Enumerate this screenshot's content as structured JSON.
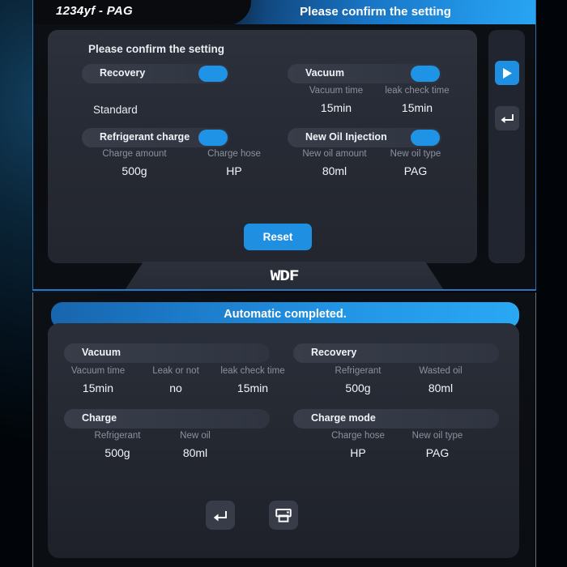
{
  "top_panel": {
    "titlebar": {
      "model": "1234yf - PAG",
      "title": "Please confirm the setting"
    },
    "card_heading": "Please confirm the setting",
    "standard_label": "Standard",
    "sections": {
      "recovery": {
        "label": "Recovery",
        "toggle": "on"
      },
      "refrigerant_charge": {
        "label": "Refrigerant charge",
        "toggle": "on",
        "fields": [
          {
            "label": "Charge amount",
            "value": "500g"
          },
          {
            "label": "Charge hose",
            "value": "HP"
          }
        ]
      },
      "vacuum": {
        "label": "Vacuum",
        "toggle": "on",
        "fields": [
          {
            "label": "Vacuum time",
            "value": "15min"
          },
          {
            "label": "leak check time",
            "value": "15min"
          }
        ]
      },
      "new_oil_injection": {
        "label": "New Oil Injection",
        "toggle": "on",
        "fields": [
          {
            "label": "New oil amount",
            "value": "80ml"
          },
          {
            "label": "New oil type",
            "value": "PAG"
          }
        ]
      }
    },
    "reset_label": "Reset",
    "rail": {
      "play_icon": "play-icon",
      "back_icon": "return-arrow-icon"
    },
    "brand": "WDF"
  },
  "bottom_panel": {
    "header_title": "Automatic completed.",
    "groups": {
      "vacuum": {
        "label": "Vacuum",
        "fields": [
          {
            "label": "Vacuum time",
            "value": "15min"
          },
          {
            "label": "Leak or not",
            "value": "no"
          },
          {
            "label": "leak check time",
            "value": "15min"
          }
        ]
      },
      "recovery": {
        "label": "Recovery",
        "fields": [
          {
            "label": "Refrigerant",
            "value": "500g"
          },
          {
            "label": "Wasted oil",
            "value": "80ml"
          }
        ]
      },
      "charge": {
        "label": "Charge",
        "fields": [
          {
            "label": "Refrigerant",
            "value": "500g"
          },
          {
            "label": "New oil",
            "value": "80ml"
          }
        ]
      },
      "charge_mode": {
        "label": "Charge mode",
        "fields": [
          {
            "label": "Charge hose",
            "value": "HP"
          },
          {
            "label": "New oil type",
            "value": "PAG"
          }
        ]
      }
    },
    "toolbar": {
      "back_icon": "return-arrow-icon",
      "print_icon": "printer-icon"
    }
  },
  "colors": {
    "accent_blue": "#1f8fe2",
    "card_bg": "#262a33",
    "label_grey": "#8b919e"
  }
}
